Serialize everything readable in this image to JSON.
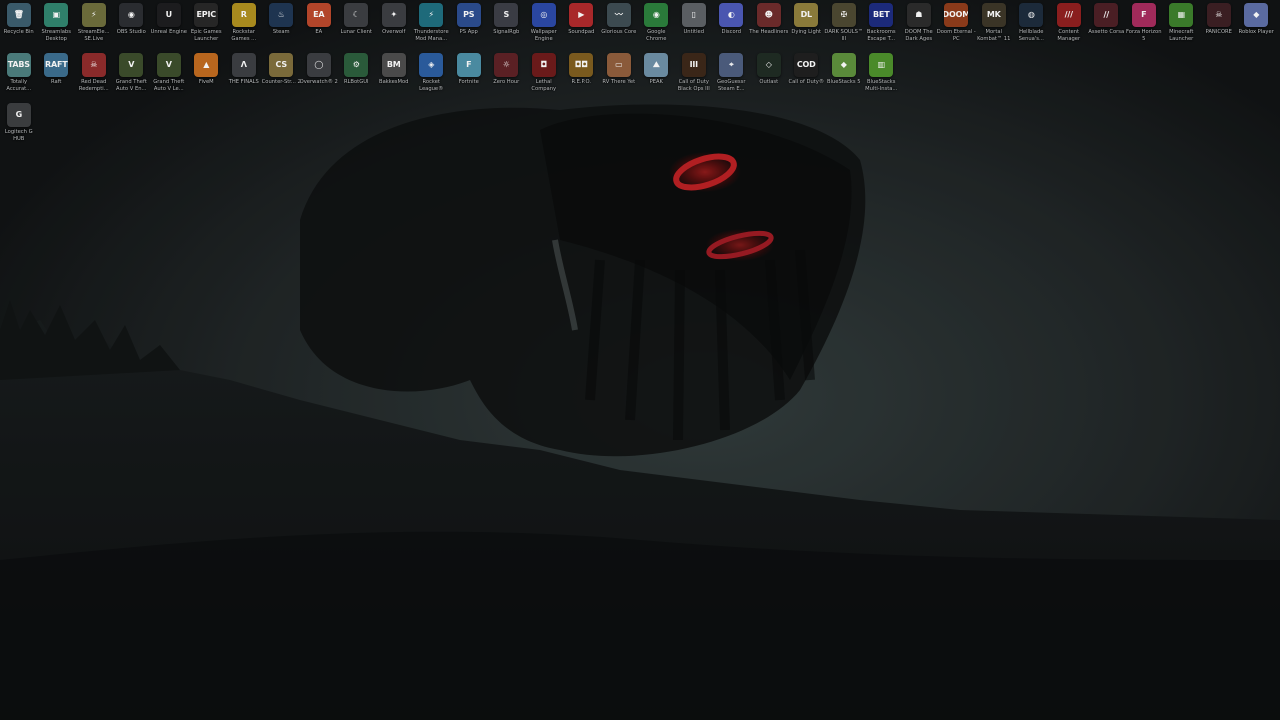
{
  "desktop": {
    "row1": [
      {
        "label": "Recycle Bin",
        "glyph": "🗑",
        "icon": "recycle-bin-icon",
        "color": "#3a5a6a"
      },
      {
        "label": "Streamlabs Desktop",
        "glyph": "▣",
        "icon": "streamlabs-icon",
        "color": "#2f7f6a"
      },
      {
        "label": "StreamEle... SE.Live",
        "glyph": "⚡",
        "icon": "streamelements-icon",
        "color": "#6a6a3a"
      },
      {
        "label": "OBS Studio",
        "glyph": "◉",
        "icon": "obs-icon",
        "color": "#2a2c30"
      },
      {
        "label": "Unreal Engine",
        "glyph": "U",
        "icon": "unreal-engine-icon",
        "color": "#1c1c1e"
      },
      {
        "label": "Epic Games Launcher",
        "glyph": "EPIC",
        "icon": "epic-games-icon",
        "color": "#262626"
      },
      {
        "label": "Rockstar Games ...",
        "glyph": "R",
        "icon": "rockstar-icon",
        "color": "#a88a1e"
      },
      {
        "label": "Steam",
        "glyph": "♨",
        "icon": "steam-icon",
        "color": "#1e3450"
      },
      {
        "label": "EA",
        "glyph": "EA",
        "icon": "ea-icon",
        "color": "#b2452a"
      },
      {
        "label": "Lunar Client",
        "glyph": "☾",
        "icon": "lunar-client-icon",
        "color": "#3a3c40"
      },
      {
        "label": "Overwolf",
        "glyph": "✦",
        "icon": "overwolf-icon",
        "color": "#3a3c40"
      },
      {
        "label": "Thunderstore Mod Mana...",
        "glyph": "⚡",
        "icon": "thunderstore-icon",
        "color": "#1e6a7a"
      },
      {
        "label": "PS App",
        "glyph": "PS",
        "icon": "ps-app-icon",
        "color": "#2a4a8a"
      },
      {
        "label": "SignalRgb",
        "glyph": "S",
        "icon": "signalrgb-icon",
        "color": "#3a3c44"
      },
      {
        "label": "Wallpaper Engine",
        "glyph": "◎",
        "icon": "wallpaper-engine-icon",
        "color": "#2a46a0"
      },
      {
        "label": "Soundpad",
        "glyph": "▶",
        "icon": "soundpad-icon",
        "color": "#a8282a"
      },
      {
        "label": "Glorious Core",
        "glyph": "〰",
        "icon": "glorious-core-icon",
        "color": "#3c4a50"
      },
      {
        "label": "Google Chrome",
        "glyph": "◉",
        "icon": "chrome-icon",
        "color": "#2a7a3a"
      },
      {
        "label": "Untitled",
        "glyph": "▯",
        "icon": "file-icon",
        "color": "#5a5e62"
      },
      {
        "label": "Discord",
        "glyph": "◐",
        "icon": "discord-icon",
        "color": "#4a56b0"
      },
      {
        "label": "The Headliners",
        "glyph": "☻",
        "icon": "headliners-icon",
        "color": "#6a2a2a"
      },
      {
        "label": "Dying Light",
        "glyph": "DL",
        "icon": "dying-light-icon",
        "color": "#8a7a3a"
      },
      {
        "label": "DARK SOULS™ III",
        "glyph": "✠",
        "icon": "dark-souls-icon",
        "color": "#4a4630"
      },
      {
        "label": "Backrooms Escape T...",
        "glyph": "BET",
        "icon": "backrooms-icon",
        "color": "#1c2a7a"
      },
      {
        "label": "DOOM The Dark Ages",
        "glyph": "☗",
        "icon": "doom-dark-ages-icon",
        "color": "#2a2a2a"
      },
      {
        "label": "Doom Eternal - PC",
        "glyph": "DOOM",
        "icon": "doom-eternal-icon",
        "color": "#8a3a1a"
      },
      {
        "label": "Mortal Kombat™ 11",
        "glyph": "MK",
        "icon": "mortal-kombat-icon",
        "color": "#3a3426"
      },
      {
        "label": "Hellblade Senua's...",
        "glyph": "◍",
        "icon": "hellblade-icon",
        "color": "#1c2a3a"
      },
      {
        "label": "Content Manager",
        "glyph": "///",
        "icon": "content-manager-icon",
        "color": "#8a1e1e"
      },
      {
        "label": "Assetto Corsa",
        "glyph": "∕∕",
        "icon": "assetto-corsa-icon",
        "color": "#4a1e24"
      },
      {
        "label": "Forza Horizon 5",
        "glyph": "F",
        "icon": "forza-icon",
        "color": "#a02a5a"
      },
      {
        "label": "Minecraft Launcher",
        "glyph": "▦",
        "icon": "minecraft-icon",
        "color": "#3a7a2a"
      },
      {
        "label": "PANICORE",
        "glyph": "☠",
        "icon": "panicore-icon",
        "color": "#3a1e22"
      },
      {
        "label": "Roblox Player",
        "glyph": "◆",
        "icon": "roblox-icon",
        "color": "#5a6aa0"
      }
    ],
    "row2": [
      {
        "label": "Totally Accurat...",
        "glyph": "TABS",
        "icon": "tabs-icon",
        "color": "#4a7a7a"
      },
      {
        "label": "Raft",
        "glyph": "RAFT",
        "icon": "raft-icon",
        "color": "#3a6a8a"
      },
      {
        "label": "Red Dead Redempti...",
        "glyph": "☠",
        "icon": "red-dead-icon",
        "color": "#8a2a2a"
      },
      {
        "label": "Grand Theft Auto V En...",
        "glyph": "V",
        "icon": "gta-v-enhanced-icon",
        "color": "#3a4a2a"
      },
      {
        "label": "Grand Theft Auto V Le...",
        "glyph": "V",
        "icon": "gta-v-legacy-icon",
        "color": "#3a4a2a"
      },
      {
        "label": "FiveM",
        "glyph": "▲",
        "icon": "fivem-icon",
        "color": "#b8661e"
      },
      {
        "label": "THE FINALS",
        "glyph": "Λ",
        "icon": "the-finals-icon",
        "color": "#3a3c40"
      },
      {
        "label": "Counter-Str... 2",
        "glyph": "CS",
        "icon": "counter-strike-icon",
        "color": "#7a6a3a"
      },
      {
        "label": "Overwatch® 2",
        "glyph": "◯",
        "icon": "overwatch-icon",
        "color": "#3a3c40"
      },
      {
        "label": "RLBotGUI",
        "glyph": "⚙",
        "icon": "rlbotgui-icon",
        "color": "#2a5a3a"
      },
      {
        "label": "BakkesMod",
        "glyph": "BM",
        "icon": "bakkesmod-icon",
        "color": "#4a4a4a"
      },
      {
        "label": "Rocket League®",
        "glyph": "◈",
        "icon": "rocket-league-icon",
        "color": "#2a5a9a"
      },
      {
        "label": "Fortnite",
        "glyph": "F",
        "icon": "fortnite-icon",
        "color": "#4a8aa0"
      },
      {
        "label": "Zero Hour",
        "glyph": "☼",
        "icon": "zero-hour-icon",
        "color": "#5a2024"
      },
      {
        "label": "Lethal Company",
        "glyph": "◘",
        "icon": "lethal-company-icon",
        "color": "#6a1a1a"
      },
      {
        "label": "R.E.P.O.",
        "glyph": "◘◘",
        "icon": "repo-icon",
        "color": "#7a5a1e"
      },
      {
        "label": "RV There Yet",
        "glyph": "▭",
        "icon": "rv-there-yet-icon",
        "color": "#8a5a3a"
      },
      {
        "label": "PEAK",
        "glyph": "⛰",
        "icon": "peak-icon",
        "color": "#6a8aa0"
      },
      {
        "label": "Call of Duty Black Ops III",
        "glyph": "III",
        "icon": "black-ops-iii-icon",
        "color": "#3a2618"
      },
      {
        "label": "GeoGuessr Steam E...",
        "glyph": "⌖",
        "icon": "geoguessr-icon",
        "color": "#4a5a7a"
      },
      {
        "label": "Outlast",
        "glyph": "◇",
        "icon": "outlast-icon",
        "color": "#1e2a22"
      },
      {
        "label": "Call of Duty®",
        "glyph": "COD",
        "icon": "call-of-duty-icon",
        "color": "#1e1e1e"
      },
      {
        "label": "BlueStacks 5",
        "glyph": "◆",
        "icon": "bluestacks5-icon",
        "color": "#5a8a3a"
      },
      {
        "label": "BlueStacks Multi-Insta...",
        "glyph": "▥",
        "icon": "bluestacks-multi-icon",
        "color": "#4a8a2a"
      }
    ],
    "row3": [
      {
        "label": "Logitech G HUB",
        "glyph": "G",
        "icon": "logitech-g-hub-icon",
        "color": "#3a3c3e"
      }
    ]
  }
}
